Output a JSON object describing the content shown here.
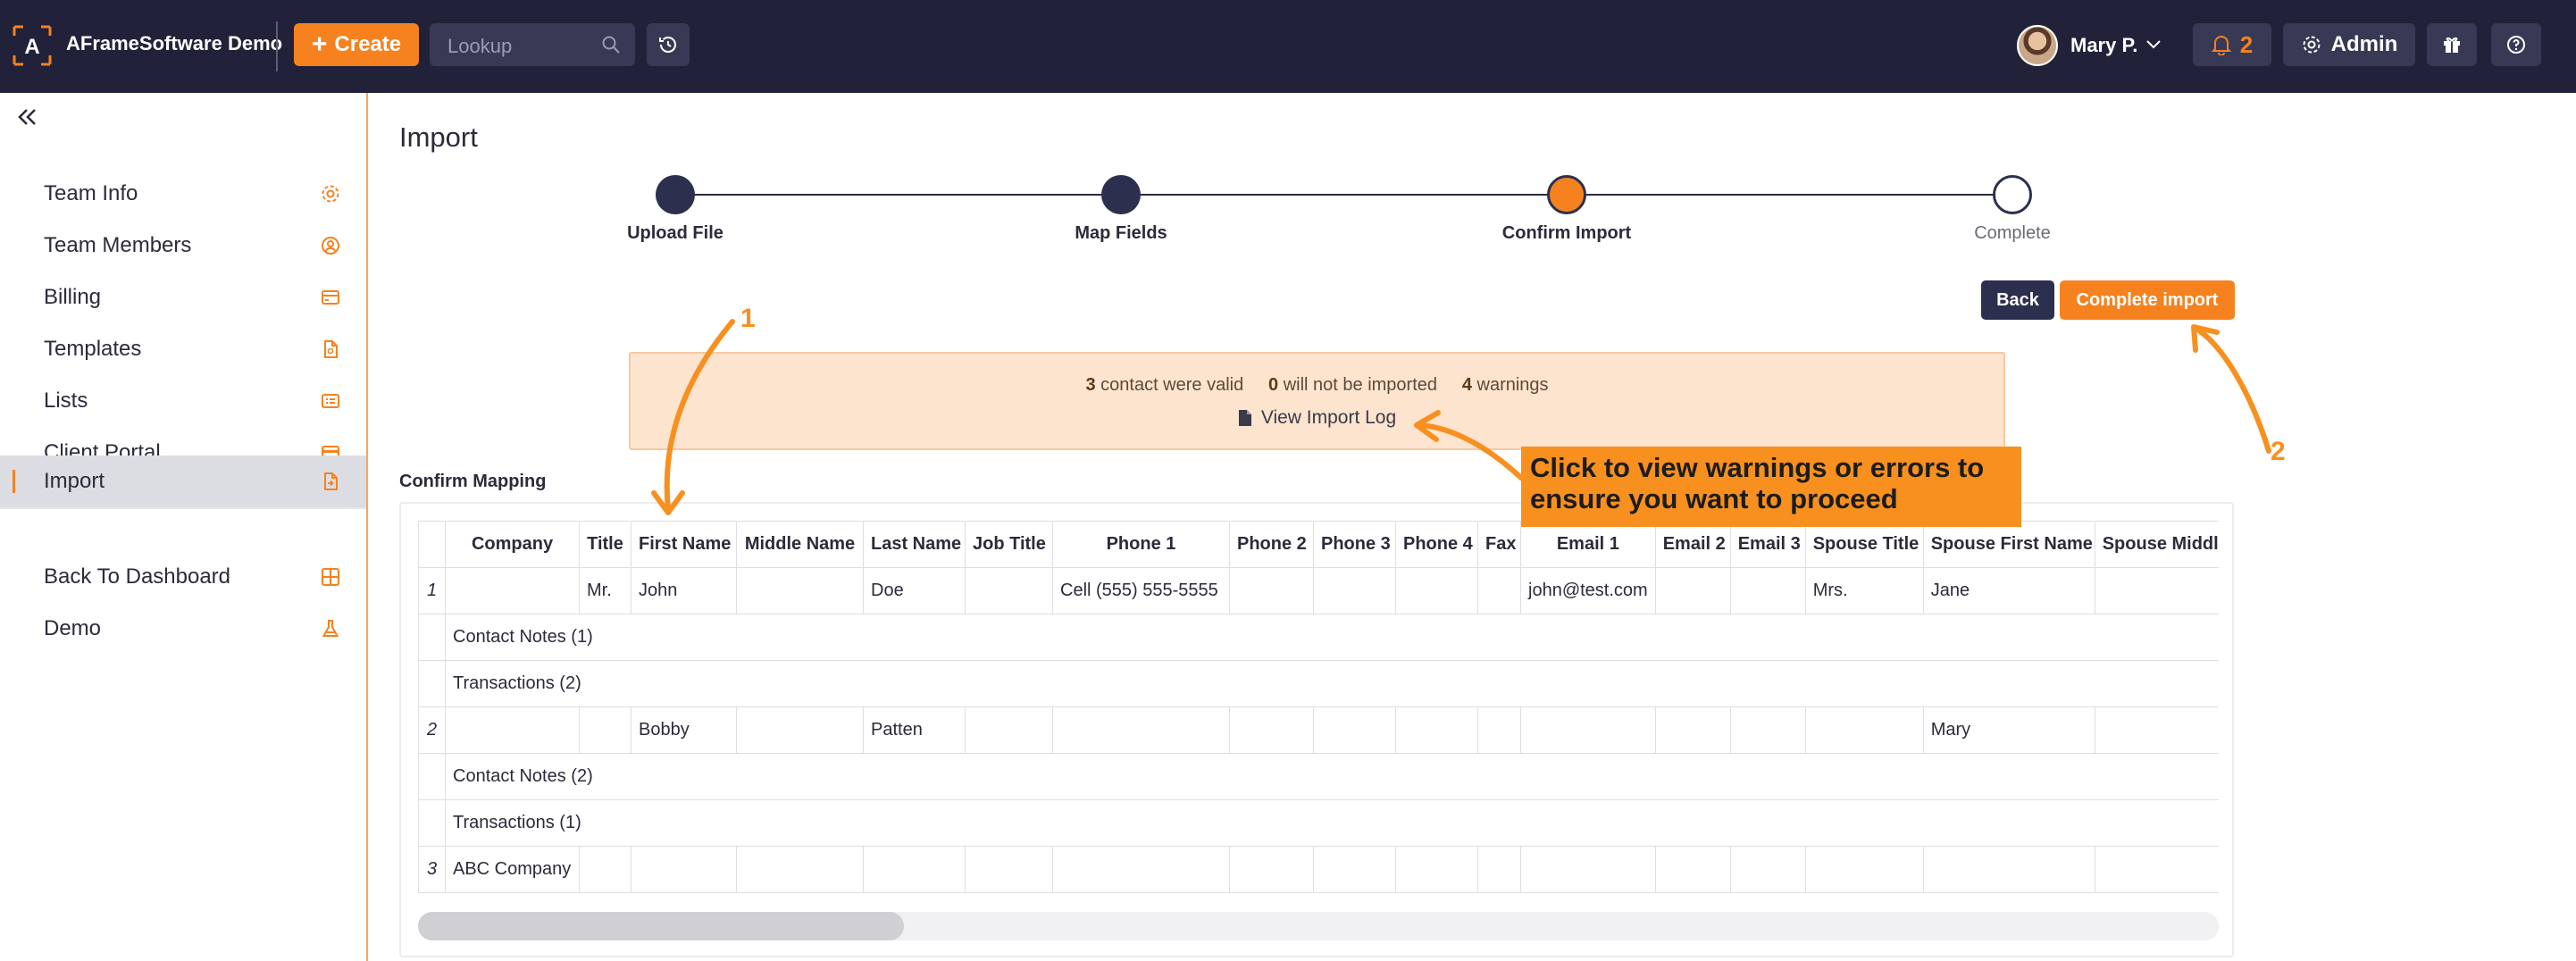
{
  "topbar": {
    "brand": "AFrameSoftware Demo",
    "create_label": "Create",
    "lookup_placeholder": "Lookup",
    "user_name": "Mary P.",
    "notif_count": "2",
    "admin_label": "Admin"
  },
  "sidebar": {
    "items": [
      {
        "label": "Team Info",
        "icon": "gear-icon"
      },
      {
        "label": "Team Members",
        "icon": "user-circle-icon"
      },
      {
        "label": "Billing",
        "icon": "credit-card-icon"
      },
      {
        "label": "Templates",
        "icon": "file-icon"
      },
      {
        "label": "Lists",
        "icon": "list-icon"
      },
      {
        "label": "Client Portal",
        "icon": "portal-card-icon"
      },
      {
        "label": "Import",
        "icon": "file-import-icon"
      }
    ],
    "bottom_items": [
      {
        "label": "Back To Dashboard",
        "icon": "grid-icon"
      },
      {
        "label": "Demo",
        "icon": "flask-icon"
      }
    ]
  },
  "page": {
    "title": "Import",
    "steps": [
      {
        "label": "Upload File",
        "state": "done"
      },
      {
        "label": "Map Fields",
        "state": "done"
      },
      {
        "label": "Confirm Import",
        "state": "current"
      },
      {
        "label": "Complete",
        "state": "pending"
      }
    ],
    "back_label": "Back",
    "complete_label": "Complete import"
  },
  "summary": {
    "valid_count": "3",
    "valid_text": "contact were valid",
    "not_imported_count": "0",
    "not_imported_text": "will not be imported",
    "warnings_count": "4",
    "warnings_text": "warnings",
    "log_link": "View Import Log"
  },
  "annotations": {
    "callout_line1": "Click to view warnings or errors to",
    "callout_line2": "ensure you want to proceed",
    "marker1": "1",
    "marker2": "2"
  },
  "mapping": {
    "title": "Confirm Mapping",
    "columns": [
      "",
      "Company",
      "Title",
      "First Name",
      "Middle Name",
      "Last Name",
      "Job Title",
      "Phone 1",
      "Phone 2",
      "Phone 3",
      "Phone 4",
      "Fax",
      "Email 1",
      "Email 2",
      "Email 3",
      "Spouse Title",
      "Spouse First Name",
      "Spouse Middle N"
    ],
    "rows": [
      {
        "type": "data",
        "cells": [
          "1",
          "",
          "Mr.",
          "John",
          "",
          "Doe",
          "",
          "Cell (555) 555-5555",
          "",
          "",
          "",
          "",
          "john@test.com",
          "",
          "",
          "Mrs.",
          "Jane",
          ""
        ]
      },
      {
        "type": "sub",
        "text": "Contact Notes (1)"
      },
      {
        "type": "sub",
        "text": "Transactions (2)"
      },
      {
        "type": "data",
        "cells": [
          "2",
          "",
          "",
          "Bobby",
          "",
          "Patten",
          "",
          "",
          "",
          "",
          "",
          "",
          "",
          "",
          "",
          "",
          "Mary",
          ""
        ]
      },
      {
        "type": "sub",
        "text": "Contact Notes (2)"
      },
      {
        "type": "sub",
        "text": "Transactions (1)"
      },
      {
        "type": "data",
        "cells": [
          "3",
          "ABC Company",
          "",
          "",
          "",
          "",
          "",
          "",
          "",
          "",
          "",
          "",
          "",
          "",
          "",
          "",
          "",
          ""
        ]
      }
    ],
    "scroll_fraction": 0.27
  },
  "colors": {
    "topbar": "#21223a",
    "accent": "#f5821f",
    "step_done": "#2d2f4e",
    "summary_bg": "#fde4cf",
    "callout": "#f7901e"
  }
}
